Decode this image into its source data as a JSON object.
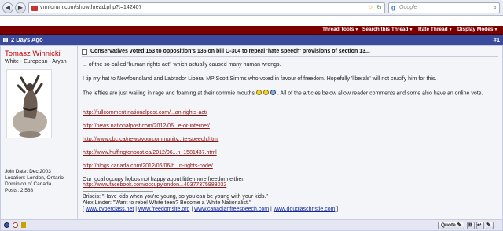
{
  "browser": {
    "url": "vnnforum.com/showthread.php?t=142407",
    "search_placeholder": "Google",
    "search_engine_icon": "google-icon"
  },
  "toolbar": {
    "thread_tools": "Thread Tools",
    "search_thread": "Search this Thread",
    "rate_thread": "Rate Thread",
    "display_modes": "Display Modes"
  },
  "post": {
    "date": "2 Days Ago",
    "number": "#1",
    "username": "Tomasz Winnicki",
    "user_title": "White - European - Aryan",
    "join_date": "Join Date: Dec 2003",
    "location_line1": "Location: London, Ontario,",
    "location_line2": "Dominion of Canada",
    "posts": "Posts: 2,588",
    "title": "Conservatives voted 153 to opposition's 136 on bill C-304 to repeal 'hate speech' provisions of section 13...",
    "para1": "... of the so-called 'human rights act', which actually caused many human wrongs.",
    "para2": "I tip my hat to Newfoundland and Labrador Liberal MP Scott Simms who voted in favour of freedom. Hopefully 'liberals' will not crucify him for this.",
    "para3_before": "The lefties are just wailing in rage and foaming at their commie mouths",
    "para3_after": ". All of the articles below allow reader comments and some also have an online vote.",
    "links": [
      "http://fullcomment.nationalpost.com/...an-rights-act/",
      "http://news.nationalpost.com/2012/06...e-or-internet/",
      "http://www.cbc.ca/news/yourcommunity...te-speech.html",
      "http://www.huffingtonpost.ca/2012/06...n_1581437.html",
      "http://blogs.canada.com/2012/06/06/h...n-rights-code/"
    ],
    "local_text": "Our local occupy hobos not happy about little more freedom either.",
    "local_link": "http://www.facebook.com/occupylondon...40377375983032",
    "sig_line1": "Briseis: \"Have kids when you're young, so you can be young with your kids.\"",
    "sig_line2": "Alex Linder: \"Want to rebel White teen? Become a White Nationalist.\"",
    "sig_links": [
      "www.cyberclass.net",
      "www.freedomsite.org",
      "www.canadianfreespeech.com",
      "www.douglaschristie.com"
    ],
    "quote_label": "Quote"
  }
}
